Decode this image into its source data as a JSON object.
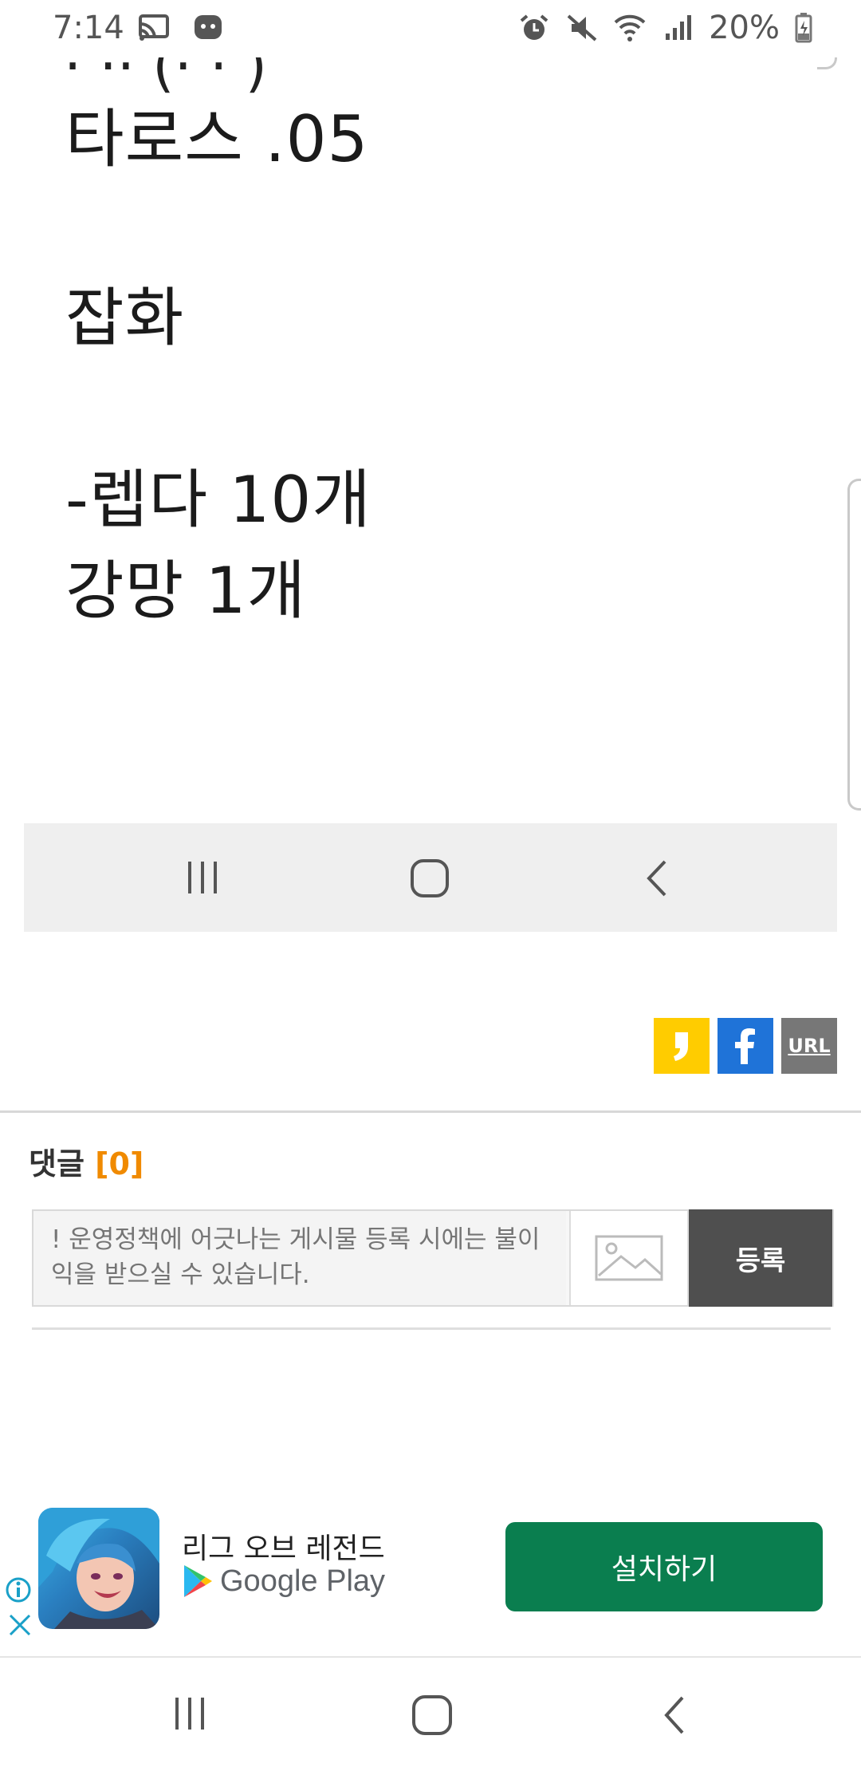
{
  "status_bar": {
    "time": "7:14",
    "battery": "20%",
    "icons": [
      "cast-icon",
      "chat-bubble-icon",
      "alarm-icon",
      "mute-icon",
      "wifi-icon",
      "signal-icon",
      "battery-charging-icon"
    ]
  },
  "embedded_screenshot": {
    "lines": [
      "타로스 .05",
      "잡화",
      "-렙다 10개",
      "강망 1개"
    ],
    "nav_icons": [
      "recent-apps-icon",
      "home-icon",
      "back-icon"
    ]
  },
  "share": {
    "buttons": [
      "kakao-icon",
      "facebook-icon",
      "url-icon"
    ],
    "url_label": "URL"
  },
  "comments": {
    "title": "댓글",
    "count": "[0]",
    "placeholder": "! 운영정책에 어긋나는 게시물 등록 시에는 불이익을 받으실 수 있습니다.",
    "submit_label": "등록"
  },
  "ad": {
    "title": "리그 오브 레전드",
    "store": "Google Play",
    "install_label": "설치하기",
    "colors": {
      "install_button": "#0a7e4f",
      "info_icon": "#1aa0c8"
    }
  },
  "system_nav": {
    "icons": [
      "recent-apps-icon",
      "home-icon",
      "back-icon"
    ]
  }
}
